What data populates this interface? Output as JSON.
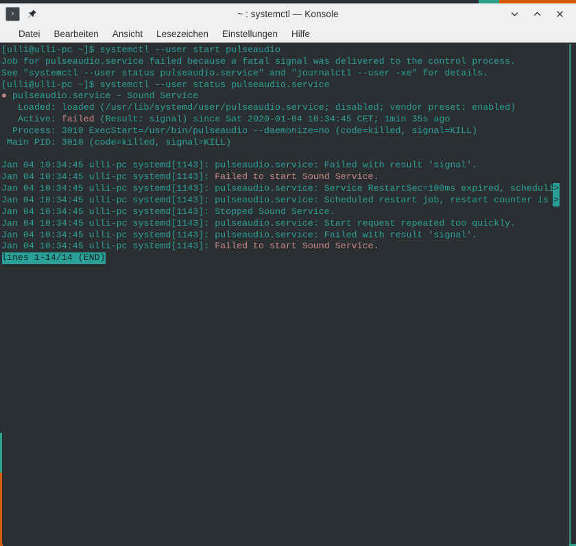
{
  "window": {
    "title": "~ : systemctl — Konsole",
    "app_icon": "terminal-prompt-icon",
    "pin_icon": "pin-icon",
    "buttons": {
      "minimize": "minimize-icon",
      "maximize": "maximize-icon",
      "close": "close-icon"
    },
    "accent_colors": {
      "dark": "#2b2f35",
      "teal": "#2ba089",
      "orange": "#d4590f"
    }
  },
  "menubar": {
    "items": [
      {
        "label": "Datei"
      },
      {
        "label": "Bearbeiten"
      },
      {
        "label": "Ansicht"
      },
      {
        "label": "Lesezeichen"
      },
      {
        "label": "Einstellungen"
      },
      {
        "label": "Hilfe"
      }
    ]
  },
  "terminal": {
    "background": "#2c2f31",
    "foreground": "#2aa198",
    "error_color": "#c98b8b",
    "highlight_bg": "#2aa198",
    "highlight_fg": "#1c2123",
    "lines": [
      {
        "text": "[ulli@ulli-pc ~]$ systemctl --user start pulseaudio"
      },
      {
        "text": "Job for pulseaudio.service failed because a fatal signal was delivered to the control process."
      },
      {
        "text": "See \"systemctl --user status pulseaudio.service\" and \"journalctl --user -xe\" for details."
      },
      {
        "text": "[ulli@ulli-pc ~]$ systemctl --user status pulseaudio.service"
      },
      {
        "bullet": "●",
        "text": " pulseaudio.service - Sound Service"
      },
      {
        "text": "   Loaded: loaded (/usr/lib/systemd/user/pulseaudio.service; disabled; vendor preset: enabled)"
      },
      {
        "pre": "   Active: ",
        "error": "failed",
        "post": " (Result: signal) since Sat 2020-01-04 10:34:45 CET; 1min 35s ago"
      },
      {
        "text": "  Process: 3010 ExecStart=/usr/bin/pulseaudio --daemonize=no (code=killed, signal=KILL)"
      },
      {
        "text": " Main PID: 3010 (code=killed, signal=KILL)"
      },
      {
        "text": ""
      },
      {
        "text": "Jan 04 10:34:45 ulli-pc systemd[1143]: pulseaudio.service: Failed with result 'signal'."
      },
      {
        "pre": "Jan 04 10:34:45 ulli-pc systemd[1143]: ",
        "error": "Failed to start Sound Service."
      },
      {
        "text": "Jan 04 10:34:45 ulli-pc systemd[1143]: pulseaudio.service: Service RestartSec=100ms expired, scheduli",
        "truncated": ">"
      },
      {
        "text": "Jan 04 10:34:45 ulli-pc systemd[1143]: pulseaudio.service: Scheduled restart job, restart counter is ",
        "truncated": ">"
      },
      {
        "text": "Jan 04 10:34:45 ulli-pc systemd[1143]: Stopped Sound Service."
      },
      {
        "text": "Jan 04 10:34:45 ulli-pc systemd[1143]: pulseaudio.service: Start request repeated too quickly."
      },
      {
        "text": "Jan 04 10:34:45 ulli-pc systemd[1143]: pulseaudio.service: Failed with result 'signal'."
      },
      {
        "pre": "Jan 04 10:34:45 ulli-pc systemd[1143]: ",
        "error": "Failed to start Sound Service."
      },
      {
        "highlight": "lines 1-14/14 (END)"
      }
    ]
  }
}
